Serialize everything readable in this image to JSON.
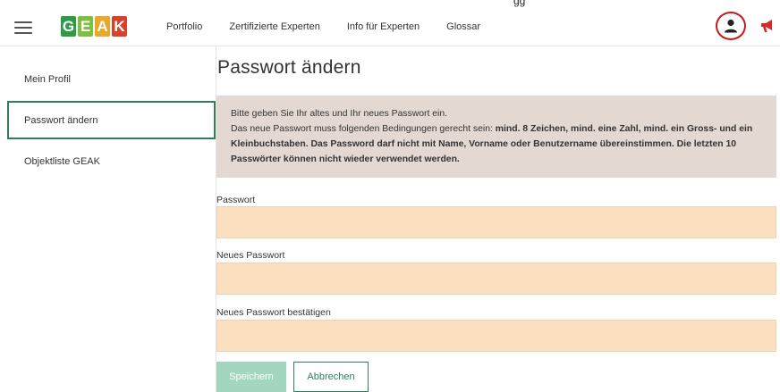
{
  "header": {
    "logo_letters": [
      {
        "char": "G",
        "color": "#2e9b4a"
      },
      {
        "char": "E",
        "color": "#7fbf3f"
      },
      {
        "char": "A",
        "color": "#e8a92a"
      },
      {
        "char": "K",
        "color": "#d8412b"
      }
    ],
    "nav": [
      "Portfolio",
      "Zertifizierte Experten",
      "Info für Experten",
      "Glossar"
    ],
    "icons": {
      "menu": "hamburger-icon",
      "profile": "user-icon",
      "announce": "megaphone-icon"
    },
    "highlight_color": "#c21a1a"
  },
  "sidebar": {
    "items": [
      {
        "label": "Mein Profil",
        "active": false
      },
      {
        "label": "Passwort ändern",
        "active": true
      },
      {
        "label": "Objektliste GEAK",
        "active": false
      }
    ],
    "active_color": "#2e7f5a"
  },
  "main": {
    "title": "Passwort ändern",
    "info": {
      "line1": "Bitte geben Sie Ihr altes und Ihr neues Passwort ein.",
      "line2_prefix": "Das neue Passwort muss folgenden Bedingungen gerecht sein: ",
      "line2_bold": "mind. 8 Zeichen, mind. eine Zahl, mind. ein Gross- und ein Kleinbuchstaben. Das Password darf nicht mit Name, Vorname oder Benutzername übereinstimmen. Die letzten 10 Passwörter können nicht wieder verwendet werden."
    },
    "fields": [
      {
        "label": "Passwort",
        "value": ""
      },
      {
        "label": "Neues Passwort",
        "value": ""
      },
      {
        "label": "Neues Passwort bestätigen",
        "value": ""
      }
    ],
    "buttons": {
      "save": "Speichern",
      "cancel": "Abbrechen"
    },
    "colors": {
      "info_bg": "#e4d8d3",
      "field_bg": "#fae0c0",
      "save_bg": "#a3d6bf"
    }
  }
}
